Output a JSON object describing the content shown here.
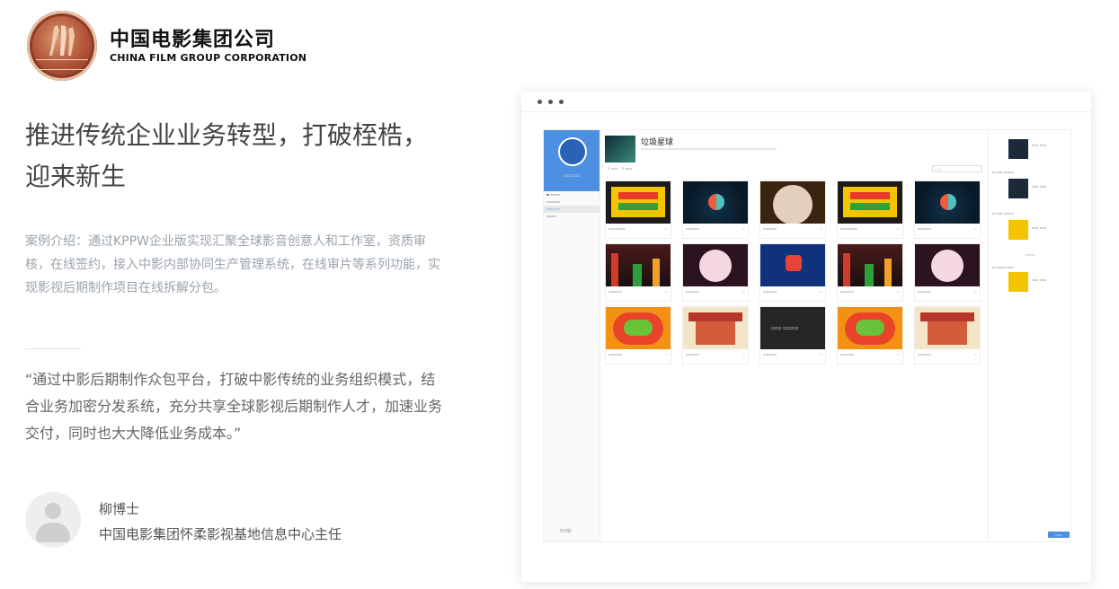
{
  "brand": {
    "name_cn": "中国电影集团公司",
    "name_en": "CHINA FILM GROUP CORPORATION"
  },
  "headline": [
    "推进传统企业业务转型，打破桎梏，",
    "迎来新生"
  ],
  "intro": "案例介绍：通过KPPW企业版实现汇聚全球影音创意人和工作室，资质审核，在线签约，接入中影内部协同生产管理系统，在线审片等系列功能，实现影视后期制作项目在线拆解分包。",
  "quote": "“通过中影后期制作众包平台，打破中影传统的业务组织模式，结合业务加密分发系统，充分共享全球影视后期制作人才，加速业务交付，同时也大大降低业务成本。”",
  "person": {
    "name": "柳博士",
    "title": "中国电影集团怀柔影视基地信息中心主任"
  },
  "mockup": {
    "project_title": "垃圾星球",
    "side_foot": "PIS制"
  },
  "colors": {
    "accent": "#4d8fe0",
    "headline": "#444444",
    "intro": "#9aa3ad"
  }
}
